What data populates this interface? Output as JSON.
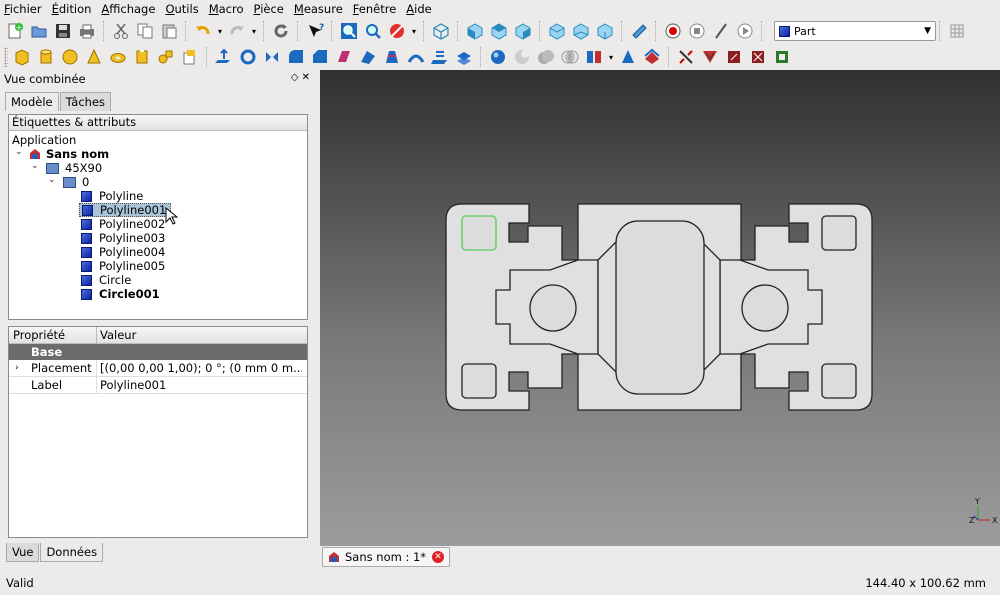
{
  "menu": [
    "Fichier",
    "Édition",
    "Affichage",
    "Outils",
    "Macro",
    "Pièce",
    "Measure",
    "Fenêtre",
    "Aide"
  ],
  "workbench": {
    "selected": "Part"
  },
  "combo_view": {
    "title": "Vue combinée",
    "tabs": [
      "Modèle",
      "Tâches"
    ],
    "tree_header": "Étiquettes & attributs",
    "tree": {
      "root": "Application",
      "document": "Sans nom",
      "group1": "45X90",
      "group2": "0",
      "items": [
        "Polyline",
        "Polyline001",
        "Polyline002",
        "Polyline003",
        "Polyline004",
        "Polyline005",
        "Circle",
        "Circle001"
      ]
    },
    "properties": {
      "col_property": "Propriété",
      "col_value": "Valeur",
      "group": "Base",
      "rows": [
        {
          "key": "Placement",
          "value": "[(0,00 0,00 1,00); 0 °; (0 mm  0 m..."
        },
        {
          "key": "Label",
          "value": "Polyline001"
        }
      ]
    },
    "bottom_tabs": [
      "Vue",
      "Données"
    ]
  },
  "document_tab": "Sans nom : 1*",
  "axes": {
    "x": "X",
    "y": "Y",
    "z": "Z"
  },
  "status": {
    "left": "Valid",
    "right": "144.40 x 100.62 mm"
  },
  "colors": {
    "viewport_top": "#303030",
    "viewport_bottom": "#9c9c9c",
    "selection": "#6fd06f",
    "profile": "#e0e0e0",
    "highlight": "#aac4d8"
  }
}
